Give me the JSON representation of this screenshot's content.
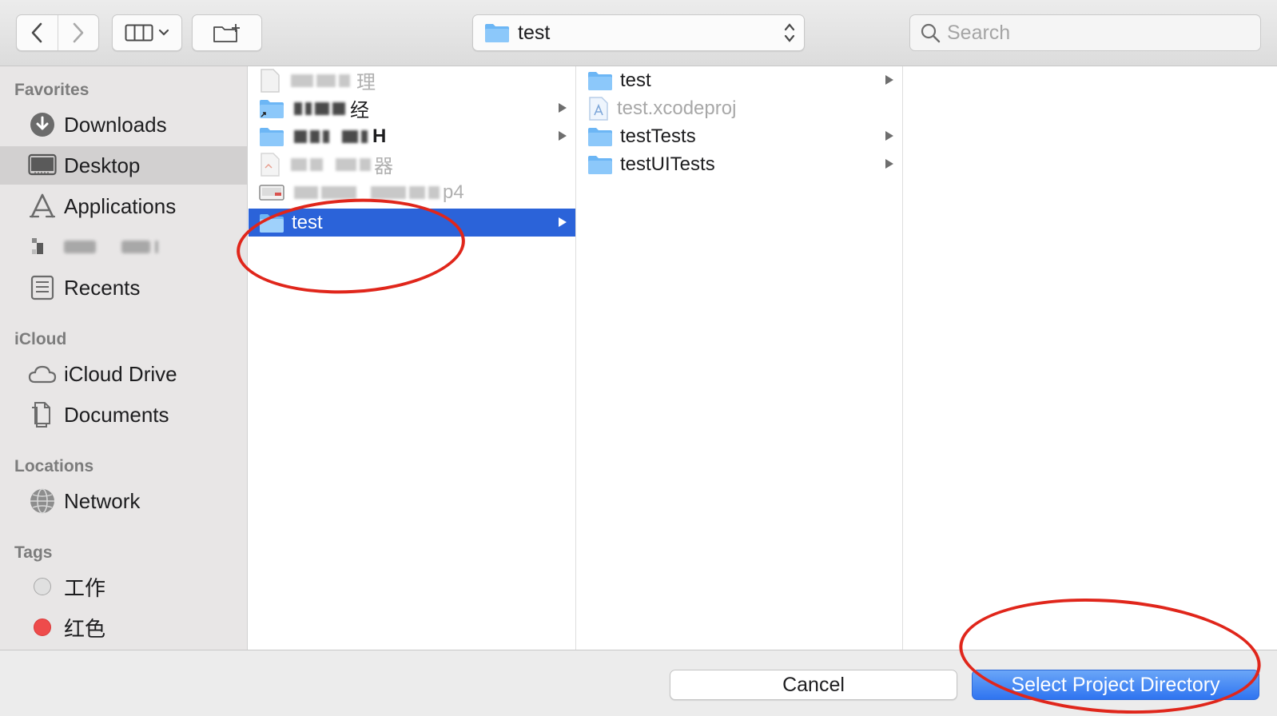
{
  "toolbar": {
    "path_label": "test",
    "search_placeholder": "Search"
  },
  "sidebar": {
    "sections": {
      "favorites": "Favorites",
      "icloud": "iCloud",
      "locations": "Locations",
      "tags": "Tags"
    },
    "favorites": [
      {
        "label": "Downloads",
        "icon": "downloads-icon"
      },
      {
        "label": "Desktop",
        "icon": "desktop-icon",
        "selected": true
      },
      {
        "label": "Applications",
        "icon": "applications-icon"
      },
      {
        "label": "Recents",
        "icon": "recents-icon"
      }
    ],
    "icloud": [
      {
        "label": "iCloud Drive",
        "icon": "cloud-icon"
      },
      {
        "label": "Documents",
        "icon": "documents-icon"
      }
    ],
    "locations": [
      {
        "label": "Network",
        "icon": "network-icon"
      }
    ],
    "tags": [
      {
        "label": "工作",
        "color": "#d6d6d6"
      },
      {
        "label": "红色",
        "color": "#ee4b4b"
      }
    ]
  },
  "columns": {
    "col1": {
      "rows": [
        {
          "label": "理",
          "blurred": true
        },
        {
          "label": "经",
          "blurred": true
        },
        {
          "label": "H",
          "blurred": true
        },
        {
          "label": "器",
          "blurred": true
        },
        {
          "label": "p4",
          "blurred": true
        },
        {
          "label": "test",
          "selected": true
        }
      ]
    },
    "col2": {
      "rows": [
        {
          "label": "test",
          "type": "folder"
        },
        {
          "label": "test.xcodeproj",
          "type": "xcodeproj"
        },
        {
          "label": "testTests",
          "type": "folder"
        },
        {
          "label": "testUITests",
          "type": "folder"
        }
      ]
    }
  },
  "footer": {
    "cancel_label": "Cancel",
    "primary_label": "Select Project Directory"
  },
  "colors": {
    "selection": "#2b63d9",
    "primary_button": "#2f74f0",
    "annotation": "#e0261b",
    "folder": "#6cb6f5"
  }
}
